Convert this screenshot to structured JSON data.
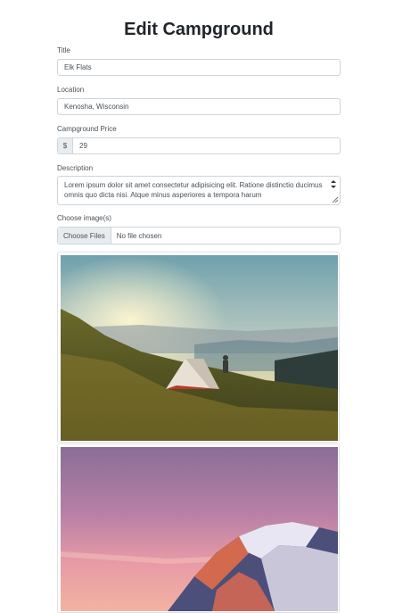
{
  "page": {
    "title": "Edit Campground"
  },
  "form": {
    "title_label": "Title",
    "title_value": "Elk Flats",
    "location_label": "Location",
    "location_value": "Kenosha, Wisconsin",
    "price_label": "Campground Price",
    "price_prefix": "$",
    "price_value": "29",
    "description_label": "Description",
    "description_value": "Lorem ipsum dolor sit amet consectetur adipisicing elit. Ratione distinctio ducimus omnis quo dicta nisi. Atque minus asperiores a tempora harum",
    "images_label": "Choose image(s)",
    "file_button": "Choose Files",
    "file_status": "No file chosen"
  },
  "images": [
    {
      "name": "campsite-tent-sunset-photo"
    },
    {
      "name": "pink-sky-snowy-mountain-photo"
    }
  ]
}
